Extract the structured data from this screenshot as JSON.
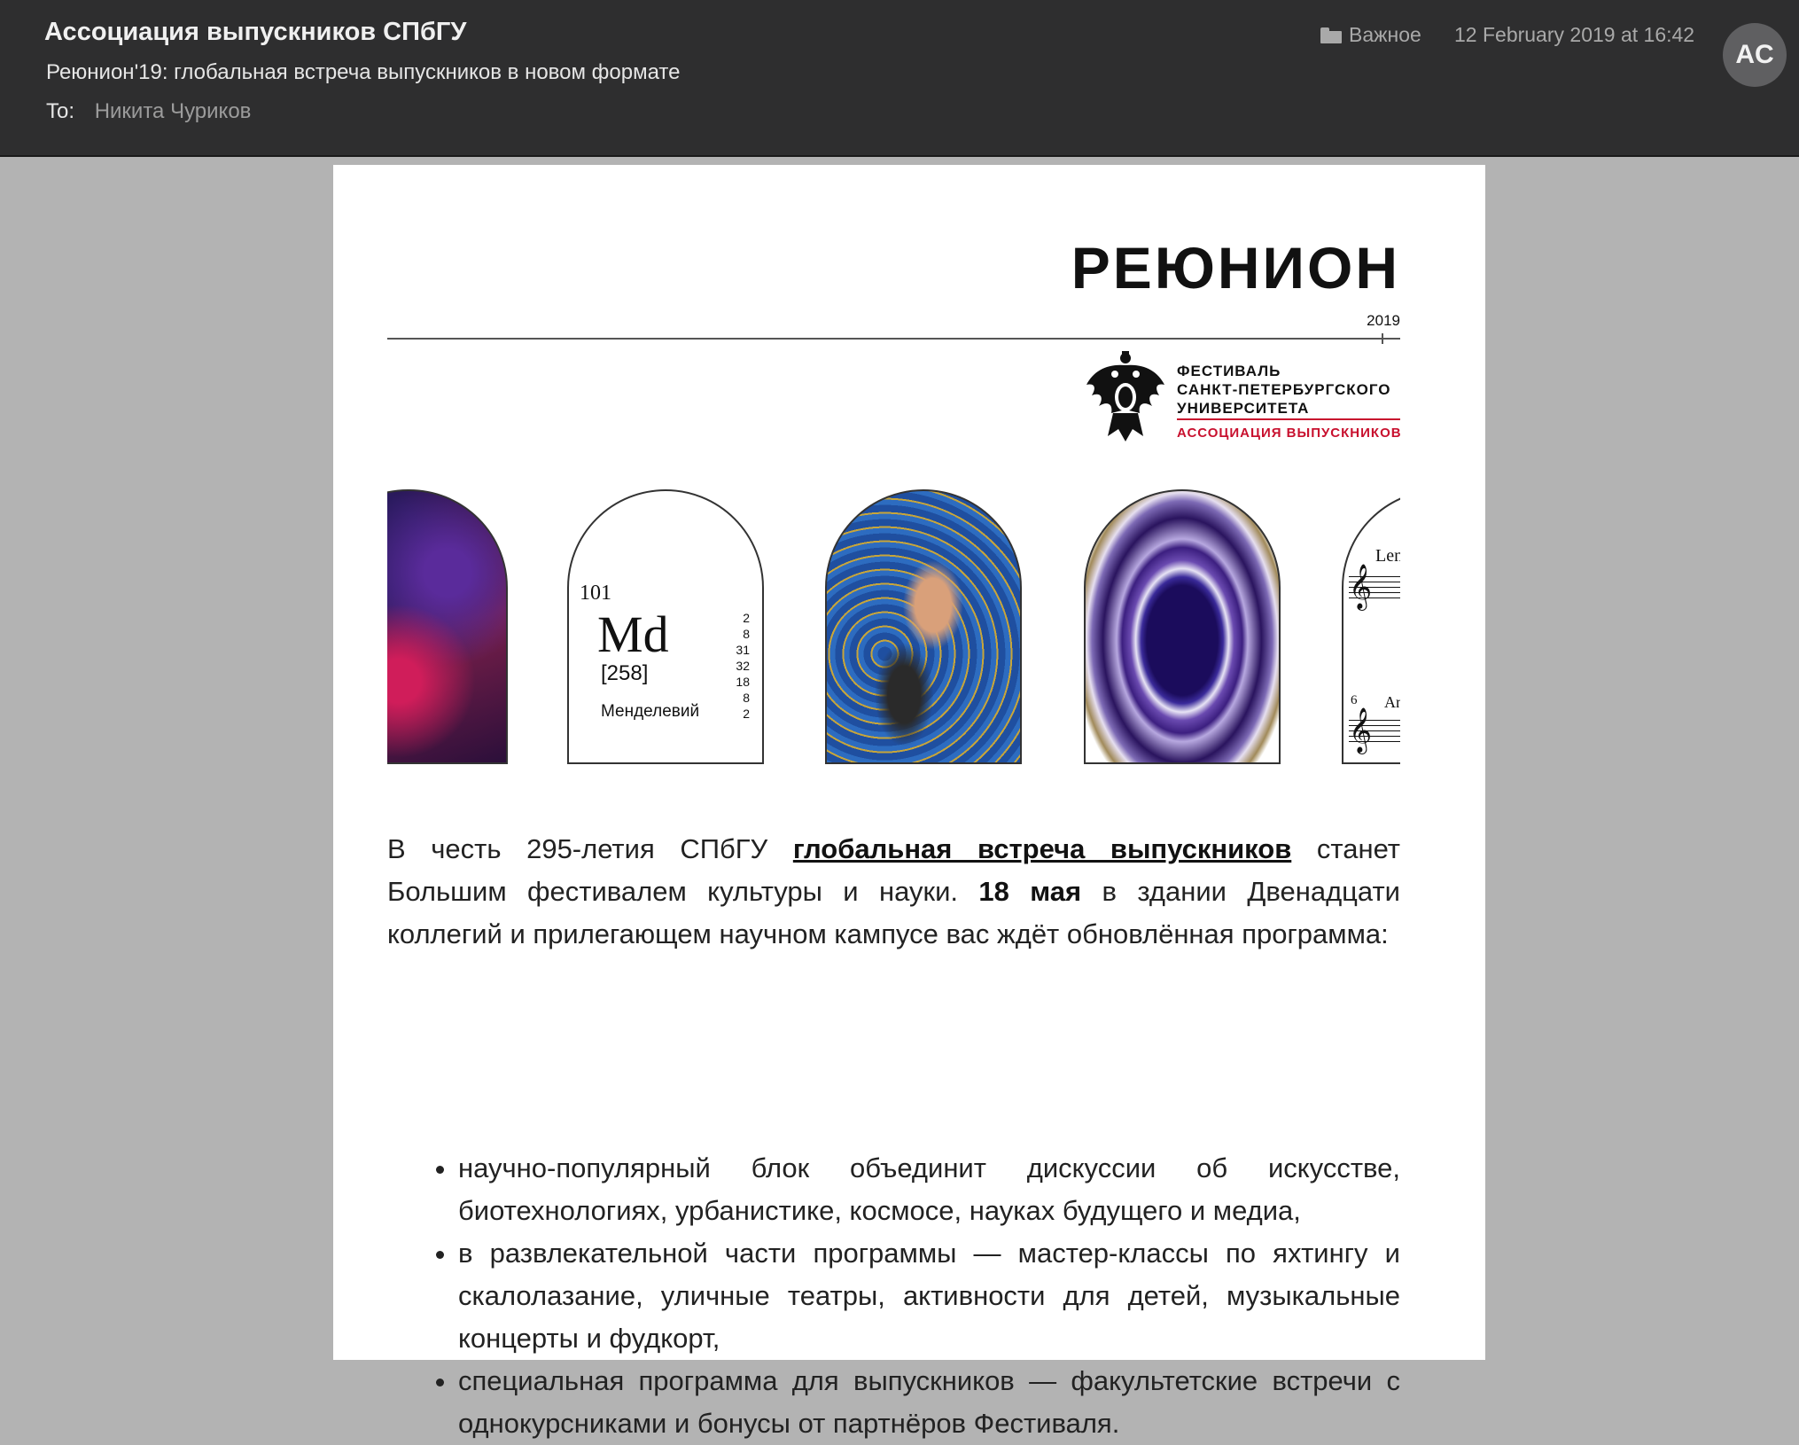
{
  "header": {
    "sender": "Ассоциация выпускников СПбГУ",
    "subject": "Реюнион'19: глобальная встреча выпускников в новом формате",
    "to_label": "To:",
    "to_name": "Никита Чуриков",
    "mailbox": "Важное",
    "date": "12 February 2019 at 16:42",
    "avatar_initials": "AC",
    "folder_icon": "folder-icon"
  },
  "logo": {
    "title": "РЕЮНИОН",
    "year": "2019",
    "fest_line1": "ФЕСТИВАЛЬ",
    "fest_line2": "САНКТ-ПЕТЕРБУРГСКОГО",
    "fest_line3": "УНИВЕРСИТЕТА",
    "alumni": "АССОЦИАЦИЯ ВЫПУСКНИКОВ",
    "accent_color": "#c8102e"
  },
  "banner": {
    "element_number": "101",
    "element_symbol": "Md",
    "element_mass": "[258]",
    "element_name": "Менделевий",
    "element_shells": [
      "2",
      "8",
      "31",
      "32",
      "18",
      "8",
      "2"
    ],
    "music_label_top": "Len",
    "music_label_bottom": "An",
    "music_bar_number": "6"
  },
  "body": {
    "p1_start": "В честь 295-летия СПбГУ",
    "p1_link": "глобальная встреча выпускников",
    "p1_mid": "станет Большим фестивалем культуры и науки.",
    "p1_bold": "18 мая",
    "p1_end": "в здании Двенадцати коллегий и прилегающем научном кампусе вас ждёт обновлённая программа:",
    "points": [
      "научно-популярный блок объединит дискуссии об искусстве, биотехнологиях, урбанистике, космосе, науках будущего и медиа,",
      "в развлекательной части программы — мастер-классы по яхтингу и скалолазание, уличные театры, активности для детей, музыкальные концерты и фудкорт,",
      "специальная программа для выпускников — факультетские встречи с однокурсниками и бонусы от партнёров Фестиваля."
    ]
  }
}
